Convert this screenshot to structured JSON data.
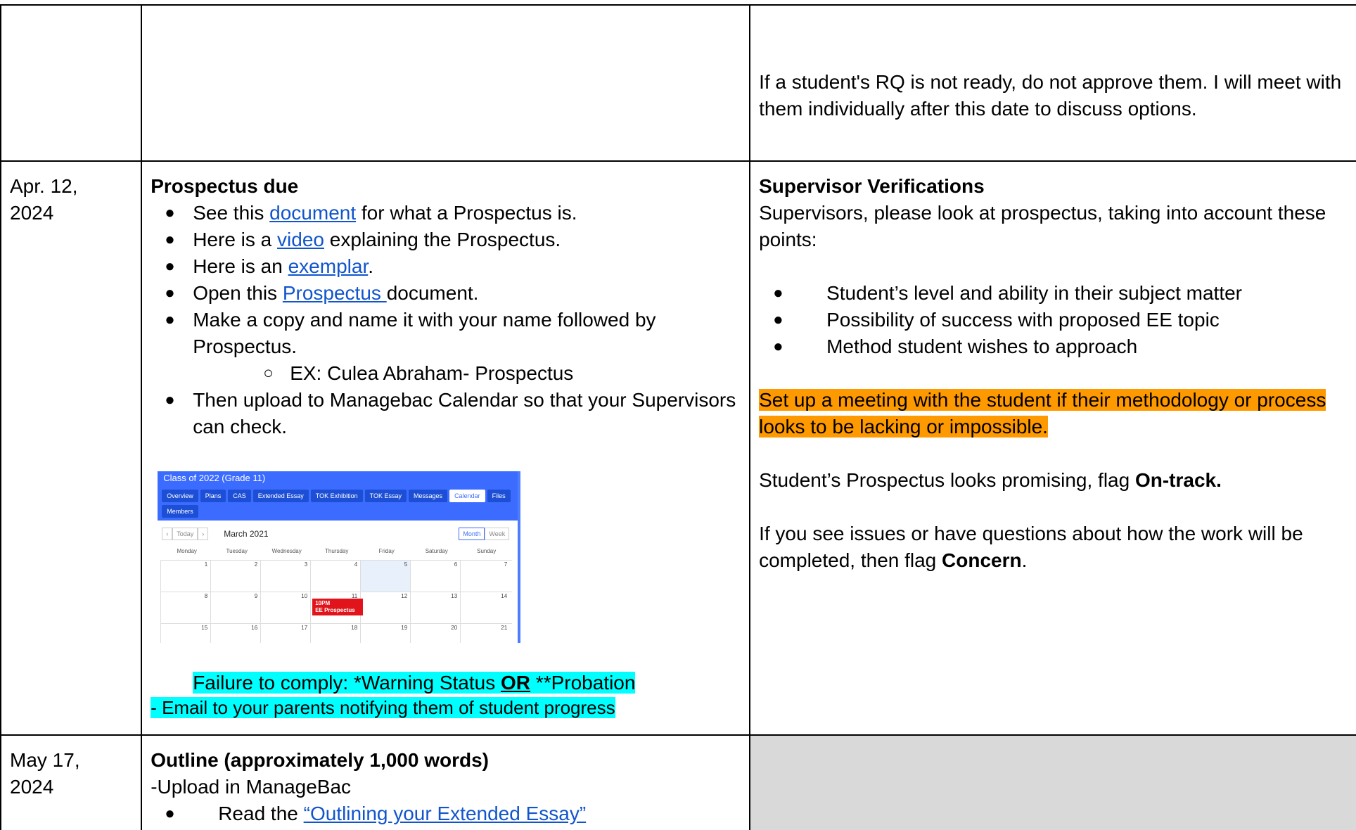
{
  "row1": {
    "note": "If a student's RQ is not ready, do not approve them. I will meet with them individually after this date to discuss options."
  },
  "row2": {
    "date_line1": "Apr. 12,",
    "date_line2": "2024",
    "heading": "Prospectus due",
    "b1_pre": "See this ",
    "b1_link": "document",
    "b1_post": " for what a Prospectus is.",
    "b2_pre": "Here is a ",
    "b2_link": "video",
    "b2_post": " explaining the Prospectus.",
    "b3_pre": "Here is an ",
    "b3_link": "exemplar",
    "b3_post": ".",
    "b4_pre": "Open this ",
    "b4_link": "Prospectus ",
    "b4_post": "document.",
    "b5": "Make a copy and name it with your name followed by Prospectus.",
    "b5_sub": "EX: Culea Abraham- Prospectus",
    "b6": "Then upload to Managebac Calendar so that your Supervisors can check.",
    "failure_pre": "Failure to comply: *Warning Status ",
    "failure_or": "OR",
    "failure_post": " **Probation",
    "failure_email": "- Email to your parents notifying them of student progress",
    "screenshot": {
      "title": "Class of 2022 (Grade 11)",
      "tabs": [
        "Overview",
        "Plans",
        "CAS",
        "Extended Essay",
        "TOK Exhibition",
        "TOK Essay",
        "Messages",
        "Calendar",
        "Files",
        "Members"
      ],
      "today": "Today",
      "month": "March 2021",
      "view_month": "Month",
      "view_week": "Week",
      "days": [
        "Monday",
        "Tuesday",
        "Wednesday",
        "Thursday",
        "Friday",
        "Saturday",
        "Sunday"
      ],
      "week1": [
        "1",
        "2",
        "3",
        "4",
        "5",
        "6",
        "7"
      ],
      "week2": [
        "8",
        "9",
        "10",
        "11",
        "12",
        "13",
        "14"
      ],
      "week3": [
        "15",
        "16",
        "17",
        "18",
        "19",
        "20",
        "21"
      ],
      "event_time": "10PM",
      "event_name": "EE Prospectus"
    },
    "sup_heading": "Supervisor Verifications",
    "sup_intro": "Supervisors, please look at prospectus, taking into account these points:",
    "sup_b1": "Student’s level and ability in their subject matter",
    "sup_b2": "Possibility of success with proposed EE topic",
    "sup_b3": "Method student wishes to approach",
    "sup_meeting": "Set up a meeting with the student if their methodology or process looks to be lacking or impossible.",
    "sup_ontrack_pre": "Student’s Prospectus looks promising, flag ",
    "sup_ontrack_bold": "On-track.",
    "sup_concern_pre": "If you see issues or have questions about how the work will be completed, then flag ",
    "sup_concern_bold": "Concern",
    "sup_concern_post": "."
  },
  "row3": {
    "date_line1": "May 17,",
    "date_line2": "2024",
    "heading": "Outline (approximately 1,000 words)",
    "line1": "-Upload in ManageBac",
    "b1_pre": "Read the ",
    "b1_link": "“Outlining your Extended Essay”"
  }
}
